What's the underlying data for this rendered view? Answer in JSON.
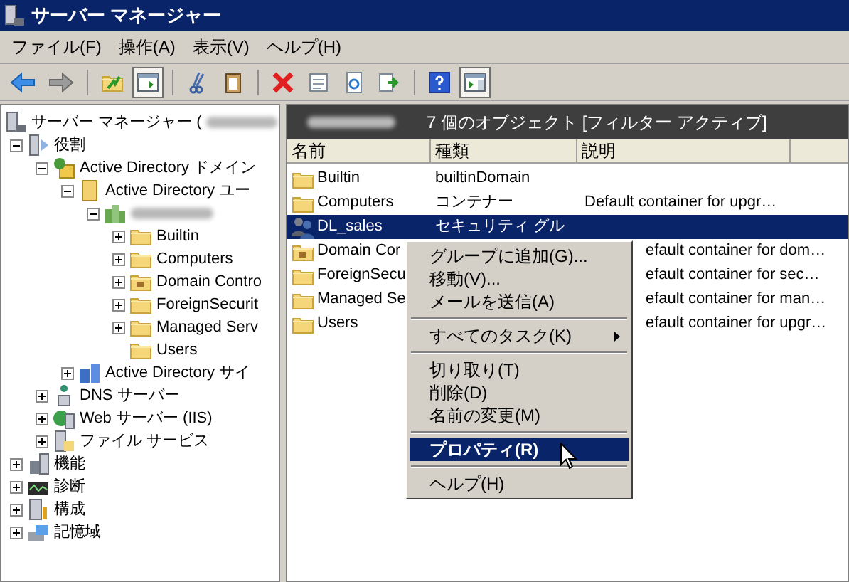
{
  "window": {
    "title": "サーバー マネージャー"
  },
  "menu_bar": [
    "ファイル(F)",
    "操作(A)",
    "表示(V)",
    "ヘルプ(H)"
  ],
  "toolbar": [
    {
      "pressed": false
    },
    {
      "pressed": false
    },
    {
      "pressed": false
    },
    {
      "pressed": true
    },
    {
      "pressed": false
    },
    {
      "pressed": false
    },
    {
      "pressed": false
    },
    {
      "pressed": false
    },
    {
      "pressed": false
    },
    {
      "pressed": false
    },
    {
      "pressed": false
    },
    {
      "pressed": true
    }
  ],
  "tree": {
    "root": {
      "label": "サーバー マネージャー ("
    },
    "items": [
      {
        "label": "役割",
        "expanded": true,
        "children": [
          {
            "label": "Active Directory ドメイン",
            "expanded": true,
            "children": [
              {
                "label": "Active Directory ユー",
                "expanded": true,
                "children": [
                  {
                    "expanded": true,
                    "children": [
                      {
                        "label": "Builtin",
                        "expanded": false
                      },
                      {
                        "label": "Computers",
                        "expanded": false
                      },
                      {
                        "label": "Domain Contro",
                        "expanded": false
                      },
                      {
                        "label": "ForeignSecurit",
                        "expanded": false
                      },
                      {
                        "label": "Managed Serv",
                        "expanded": false
                      },
                      {
                        "label": "Users"
                      }
                    ]
                  }
                ]
              },
              {
                "label": "Active Directory サイ",
                "expanded": false
              }
            ]
          },
          {
            "label": "DNS サーバー",
            "expanded": false
          },
          {
            "label": "Web サーバー (IIS)",
            "expanded": false
          },
          {
            "label": "ファイル サービス",
            "expanded": false
          }
        ]
      },
      {
        "label": "機能",
        "expanded": false
      },
      {
        "label": "診断",
        "expanded": false
      },
      {
        "label": "構成",
        "expanded": false
      },
      {
        "label": "記憶域",
        "expanded": false
      }
    ]
  },
  "list": {
    "header": {
      "text": "7 個のオブジェクト [フィルター アクティブ]"
    },
    "columns": [
      "名前",
      "種類",
      "説明"
    ],
    "rows": [
      {
        "name": "Builtin",
        "type": "builtinDomain",
        "selected": false
      },
      {
        "name": "Computers",
        "type": "コンテナー",
        "description": "Default container for upgr…",
        "selected": false
      },
      {
        "name": "DL_sales",
        "type": "セキュリティ グル",
        "selected": true
      },
      {
        "name": "Domain Cor",
        "description": "efault container for dom…",
        "selected": false
      },
      {
        "name": "ForeignSecu",
        "description": "efault container for sec…",
        "selected": false
      },
      {
        "name": "Managed Se",
        "description": "efault container for man…",
        "selected": false
      },
      {
        "name": "Users",
        "description": "efault container for upgr…",
        "selected": false
      }
    ]
  },
  "context_menu": [
    {
      "kind": "item",
      "label": "グループに追加(G)...",
      "submenu": false,
      "selected": false
    },
    {
      "kind": "item",
      "label": "移動(V)...",
      "submenu": false,
      "selected": false
    },
    {
      "kind": "item",
      "label": "メールを送信(A)",
      "submenu": false,
      "selected": false
    },
    {
      "kind": "separator"
    },
    {
      "kind": "item",
      "label": "すべてのタスク(K)",
      "submenu": true,
      "selected": false
    },
    {
      "kind": "separator"
    },
    {
      "kind": "item",
      "label": "切り取り(T)",
      "submenu": false,
      "selected": false
    },
    {
      "kind": "item",
      "label": "削除(D)",
      "submenu": false,
      "selected": false
    },
    {
      "kind": "item",
      "label": "名前の変更(M)",
      "submenu": false,
      "selected": false
    },
    {
      "kind": "separator"
    },
    {
      "kind": "item",
      "label": "プロパティ(R)",
      "submenu": false,
      "selected": true
    },
    {
      "kind": "separator"
    },
    {
      "kind": "item",
      "label": "ヘルプ(H)",
      "submenu": false,
      "selected": false
    }
  ]
}
